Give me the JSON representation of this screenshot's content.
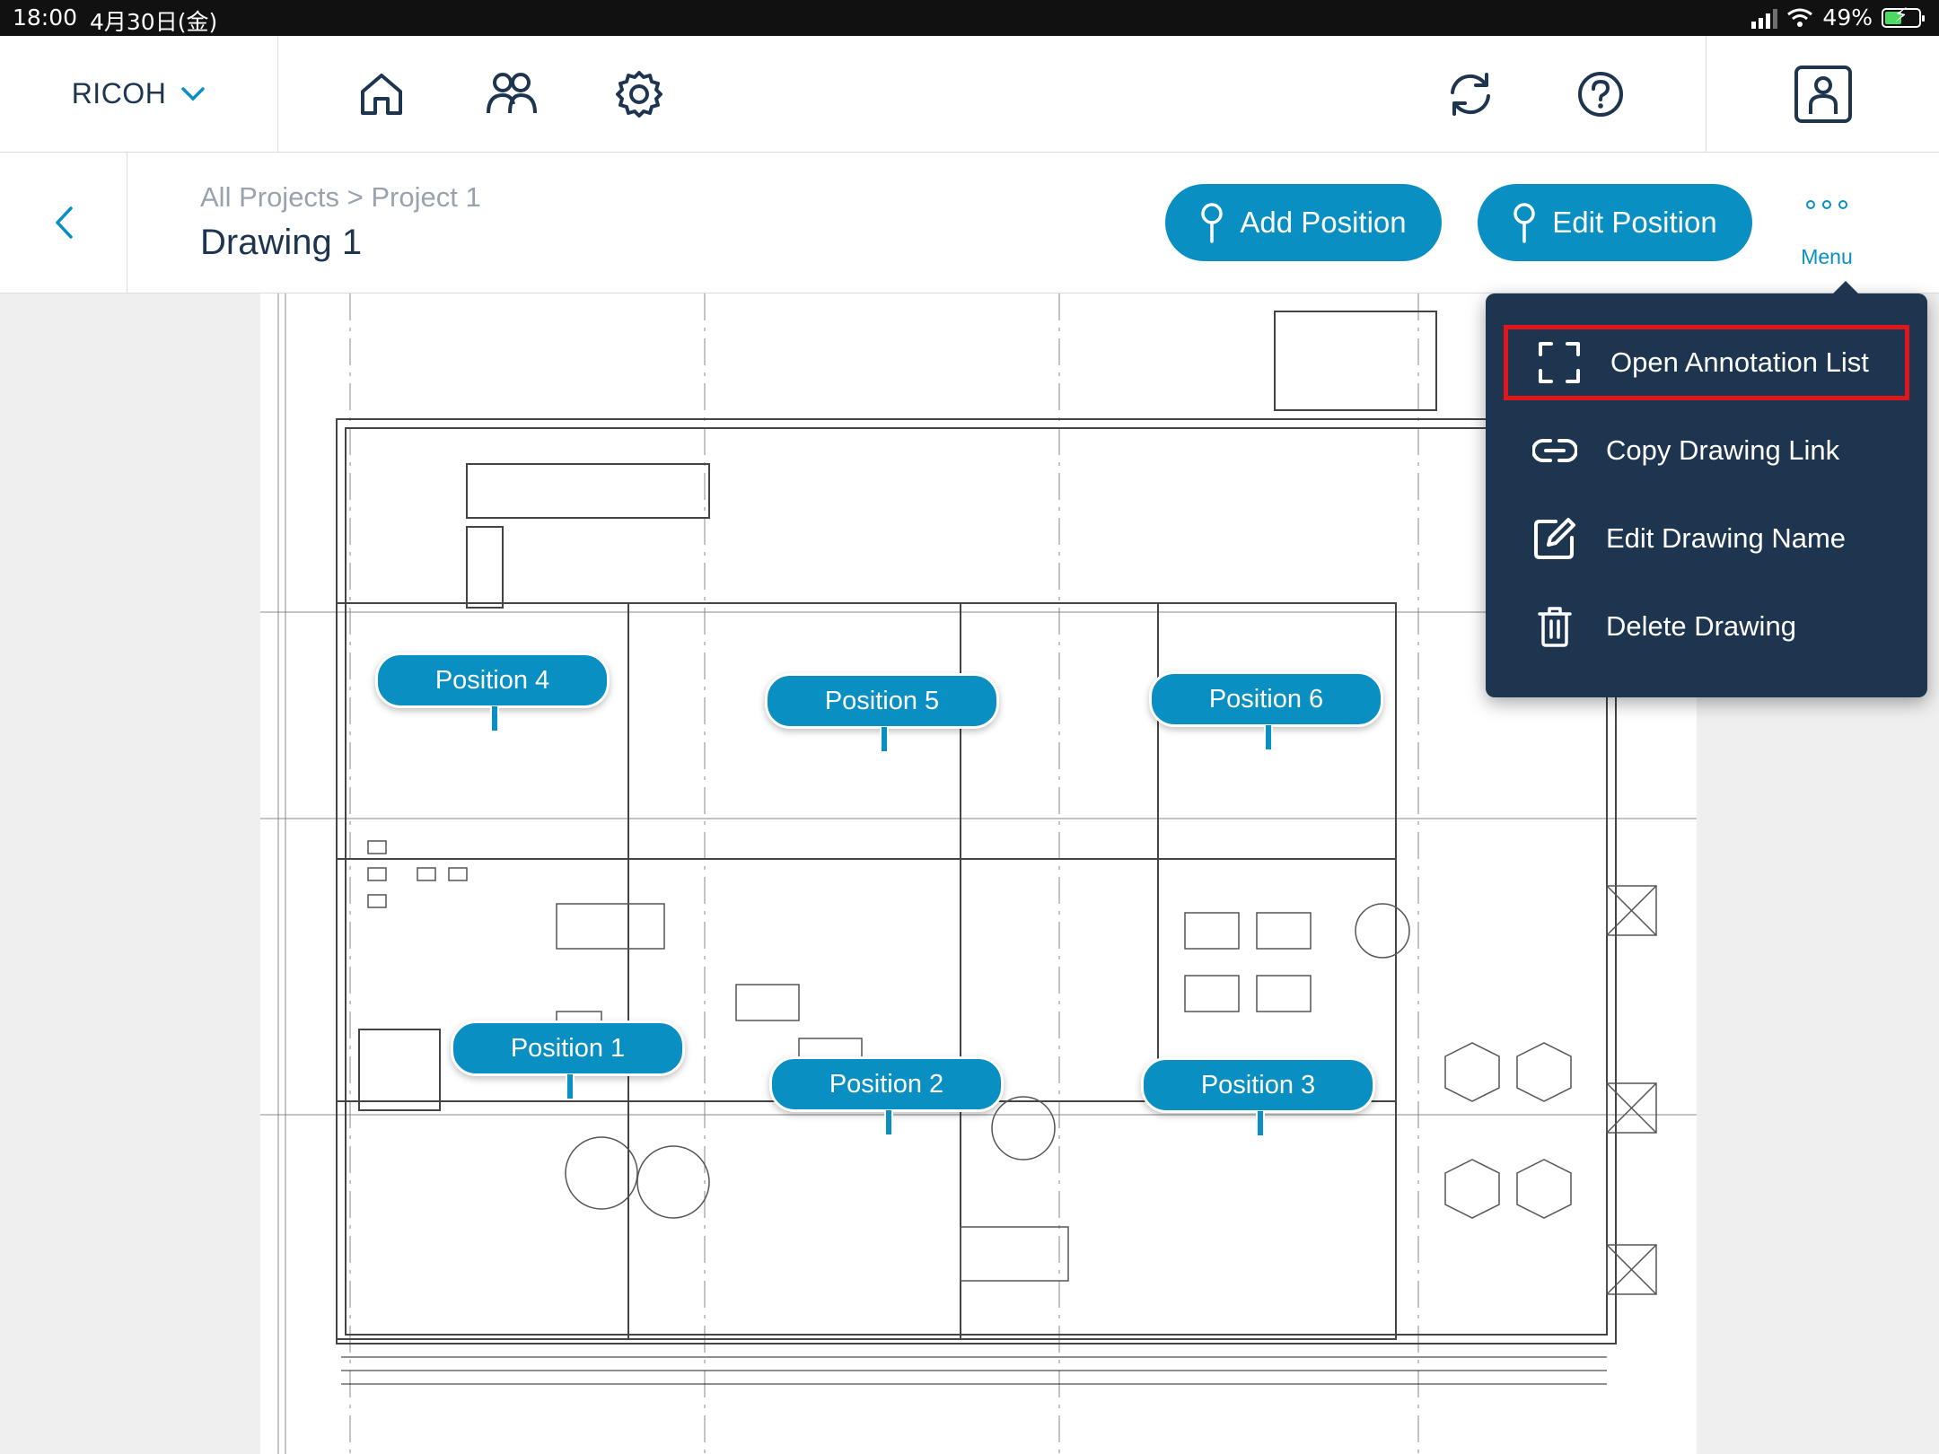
{
  "status_bar": {
    "time": "18:00",
    "date": "4月30日(金)",
    "battery": "49%"
  },
  "app_bar": {
    "brand": "RICOH",
    "icons": [
      "home-icon",
      "users-icon",
      "settings-icon",
      "sync-icon",
      "help-icon",
      "profile-icon"
    ]
  },
  "header": {
    "breadcrumb": "All Projects > Project 1",
    "title": "Drawing 1",
    "add_position_label": "Add Position",
    "edit_position_label": "Edit Position",
    "menu_label": "Menu"
  },
  "positions": [
    {
      "label": "Position 4"
    },
    {
      "label": "Position 5"
    },
    {
      "label": "Position 6"
    },
    {
      "label": "Position 1"
    },
    {
      "label": "Position 2"
    },
    {
      "label": "Position 3"
    }
  ],
  "menu": {
    "items": [
      {
        "label": "Open Annotation List",
        "icon": "expand-icon",
        "highlighted": true
      },
      {
        "label": "Copy Drawing Link",
        "icon": "link-icon"
      },
      {
        "label": "Edit Drawing Name",
        "icon": "edit-icon"
      },
      {
        "label": "Delete Drawing",
        "icon": "trash-icon"
      }
    ]
  },
  "colors": {
    "accent": "#0a8fc2",
    "navy": "#1e3550",
    "highlight": "#e0161c"
  }
}
